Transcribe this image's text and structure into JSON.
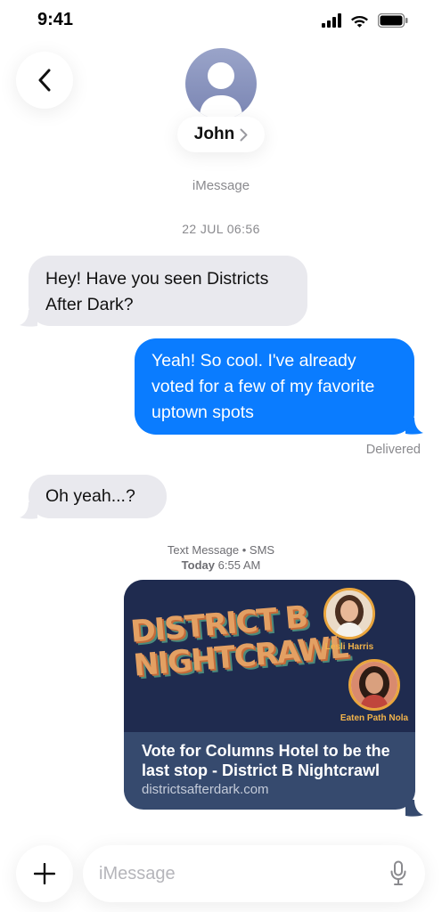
{
  "status_bar": {
    "time": "9:41",
    "icons": [
      "cellular-signal-icon",
      "wifi-icon",
      "battery-icon"
    ]
  },
  "header": {
    "back_icon": "chevron-left-icon",
    "avatar_icon": "person-icon",
    "contact_name": "John",
    "contact_chevron": "chevron-right-icon"
  },
  "conversation": {
    "service": "iMessage",
    "date": "22 JUL 06:56",
    "messages": [
      {
        "direction": "incoming",
        "text": "Hey! Have you seen Districts After Dark?"
      },
      {
        "direction": "outgoing",
        "text": "Yeah! So cool. I've already voted for a few of my favorite uptown spots"
      },
      {
        "direction": "incoming",
        "text": "Oh yeah...?"
      }
    ],
    "delivered_status": "Delivered",
    "sms_label": {
      "type": "Text Message • SMS",
      "time_prefix": "Today",
      "time": "6:55 AM"
    },
    "link_preview": {
      "image_title_line1": "DISTRICT B",
      "image_title_line2": "NIGHTCRAWL",
      "people": [
        {
          "name": "Lesli Harris"
        },
        {
          "name": "Eaten Path Nola"
        }
      ],
      "headline": "Vote for Columns Hotel to be the last stop - District B Nightcrawl",
      "domain": "districtsafterdark.com"
    }
  },
  "composer": {
    "plus_icon": "plus-icon",
    "placeholder": "iMessage",
    "mic_icon": "microphone-icon"
  },
  "colors": {
    "outgoing_bubble": "#0a7cff",
    "incoming_bubble": "#e9e9ee",
    "link_card_footer": "#364a6e",
    "link_card_image": "#1f2b4f"
  }
}
